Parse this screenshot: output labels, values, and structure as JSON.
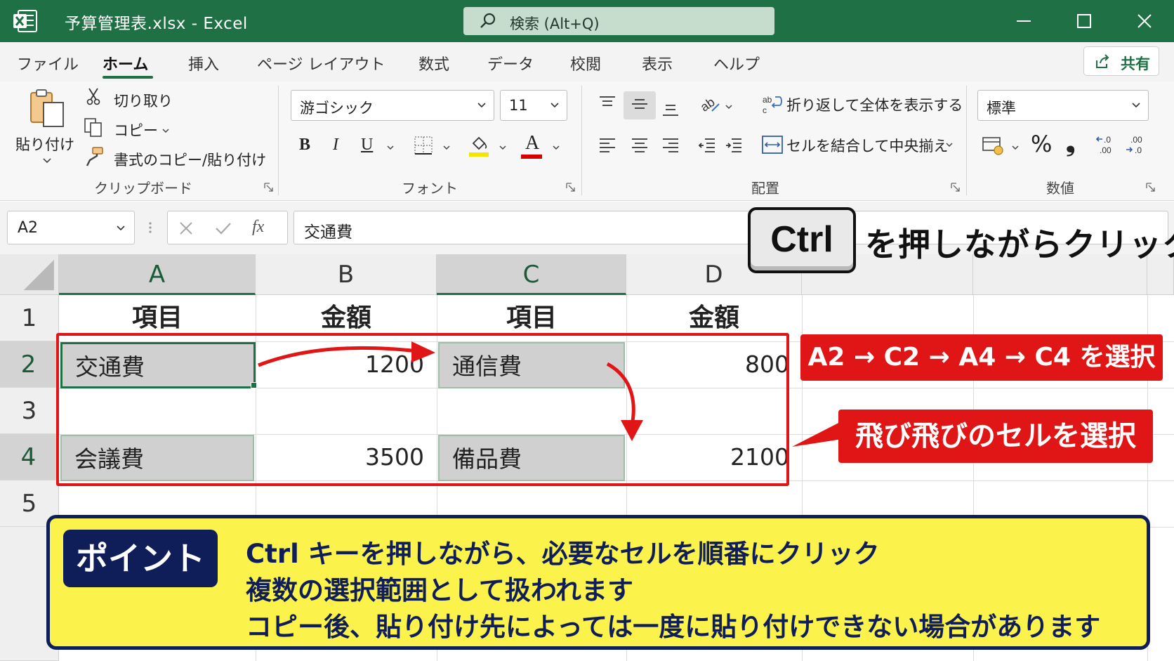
{
  "window": {
    "title": "予算管理表.xlsx  -  Excel",
    "search_label": "検索 (Alt+Q)"
  },
  "ribbon": {
    "tabs": [
      "ファイル",
      "ホーム",
      "挿入",
      "ページ レイアウト",
      "数式",
      "データ",
      "校閲",
      "表示",
      "ヘルプ"
    ],
    "active_tab": "ホーム",
    "share_label": "共有",
    "clipboard": {
      "paste": "貼り付け",
      "cut": "切り取り",
      "copy": "コピー",
      "format_painter": "書式のコピー/貼り付け",
      "group": "クリップボード"
    },
    "font": {
      "name": "游ゴシック",
      "size": "11",
      "bold": "B",
      "italic": "I",
      "underline": "U",
      "font_color_letter": "A",
      "group": "フォント"
    },
    "alignment": {
      "wrap_text": "折り返して全体を表示する",
      "merge_center": "セルを結合して中央揃え",
      "group": "配置"
    },
    "number": {
      "format": "標準",
      "percent": "%",
      "comma": "❟",
      "group": "数値"
    }
  },
  "formula_bar": {
    "name_box": "A2",
    "fx": "fx",
    "content": "交通費"
  },
  "sheet": {
    "columns": [
      "A",
      "B",
      "C",
      "D"
    ],
    "rows": [
      "1",
      "2",
      "3",
      "4",
      "5"
    ],
    "cells": {
      "A1": "項目",
      "B1": "金額",
      "C1": "項目",
      "D1": "金額",
      "A2": "交通費",
      "B2": "1200",
      "C2": "通信費",
      "D2": "800",
      "A4": "会議費",
      "B4": "3500",
      "C4": "備品費",
      "D4": "2100"
    }
  },
  "annotations": {
    "ctrl_key": "Ctrl",
    "ctrl_caption": "を押しながらクリック",
    "selection_order": "A2 → C2 → A4 → C4 を選択",
    "scattered_cells": "飛び飛びのセルを選択",
    "point_badge": "ポイント",
    "point_lines": [
      "Ctrl キーを押しながら、必要なセルを順番にクリック",
      "複数の選択範囲として扱われます",
      "コピー後、貼り付け先によっては一度に貼り付けできない場合があります"
    ]
  },
  "colors": {
    "excel_green": "#1f7145",
    "annotation_red": "#e01515",
    "point_yellow": "#fbf34b",
    "point_navy": "#0f1d59"
  }
}
